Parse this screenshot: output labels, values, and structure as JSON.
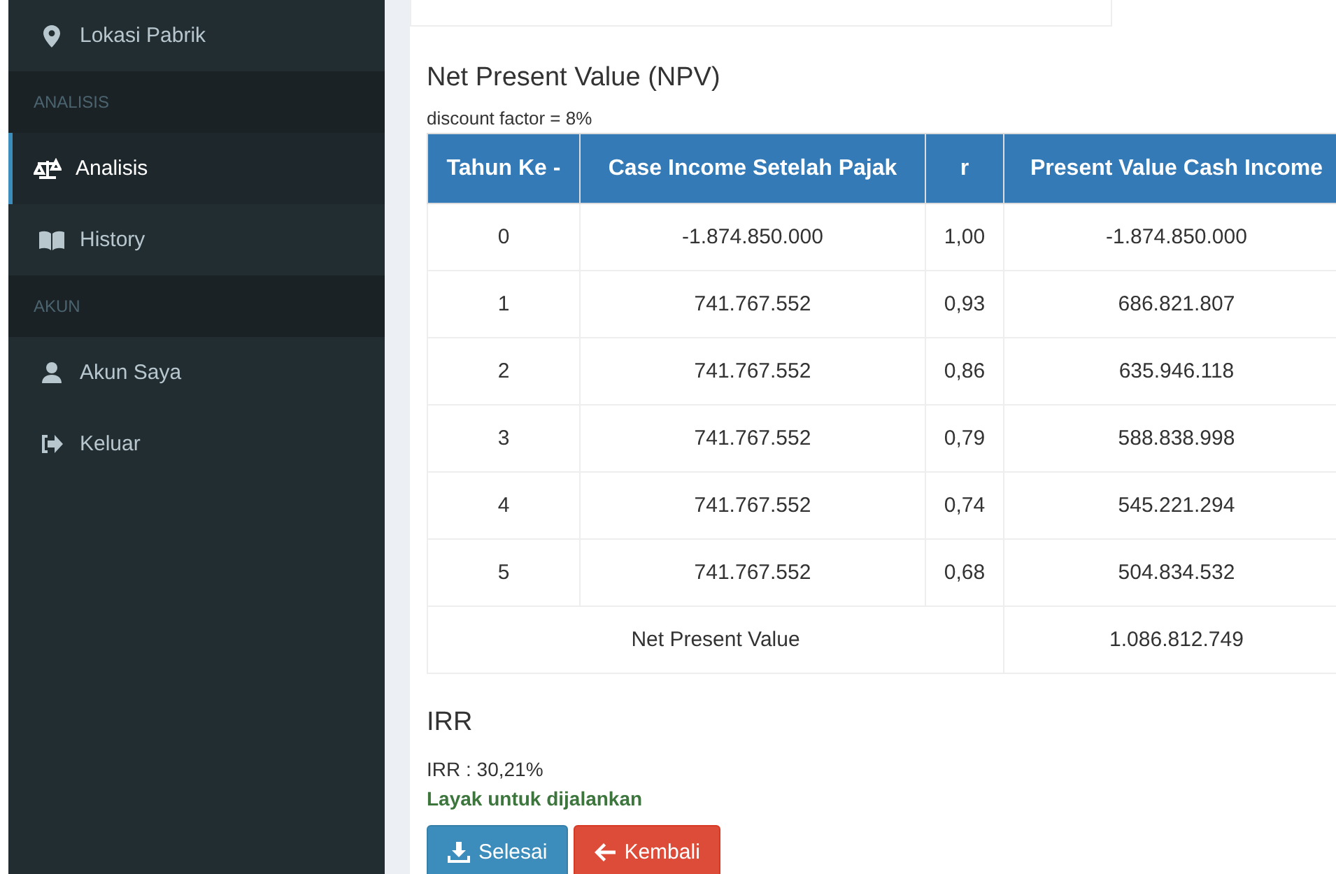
{
  "sidebar": {
    "items": [
      {
        "kind": "item",
        "label": "Lokasi Pabrik",
        "selected": false
      },
      {
        "kind": "header",
        "label": "ANALISIS"
      },
      {
        "kind": "item",
        "label": "Analisis",
        "selected": true
      },
      {
        "kind": "item",
        "label": "History",
        "selected": false
      },
      {
        "kind": "header",
        "label": "AKUN"
      },
      {
        "kind": "item",
        "label": "Akun Saya",
        "selected": false
      },
      {
        "kind": "item",
        "label": "Keluar",
        "selected": false
      }
    ]
  },
  "npv": {
    "title": "Net Present Value (NPV)",
    "note": "discount factor = 8%",
    "table": {
      "columns": [
        "Tahun Ke -",
        "Case Income Setelah Pajak",
        "r",
        "Present Value Cash Income"
      ],
      "rows": [
        [
          "0",
          "-1.874.850.000",
          "1,00",
          "-1.874.850.000"
        ],
        [
          "1",
          "741.767.552",
          "0,93",
          "686.821.807"
        ],
        [
          "2",
          "741.767.552",
          "0,86",
          "635.946.118"
        ],
        [
          "3",
          "741.767.552",
          "0,79",
          "588.838.998"
        ],
        [
          "4",
          "741.767.552",
          "0,74",
          "545.221.294"
        ],
        [
          "5",
          "741.767.552",
          "0,68",
          "504.834.532"
        ]
      ],
      "footer": {
        "label": "Net Present Value",
        "value": "1.086.812.749"
      }
    }
  },
  "irr": {
    "title": "IRR",
    "value": "IRR : 30,21%",
    "verdict": "Layak untuk dijalankan"
  },
  "buttons": [
    {
      "kind": "primary",
      "label": "Selesai"
    },
    {
      "kind": "danger",
      "label": "Kembali"
    }
  ]
}
